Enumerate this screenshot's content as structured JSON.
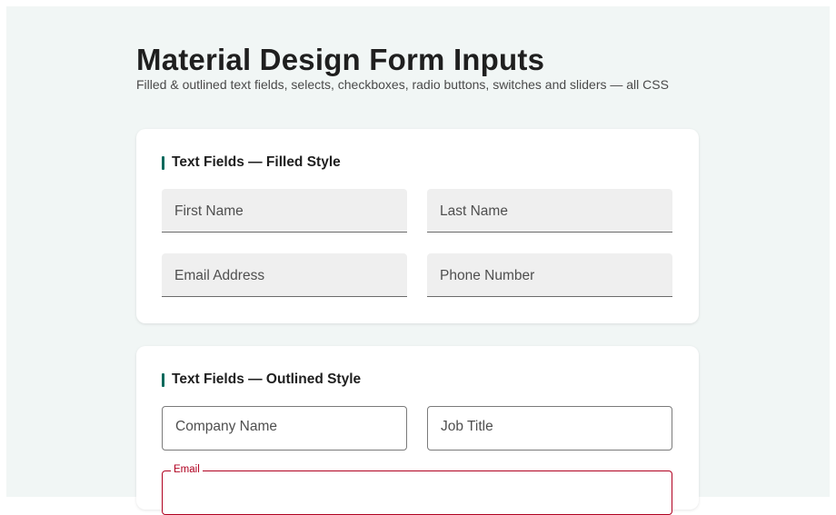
{
  "header": {
    "title": "Material Design Form Inputs",
    "subtitle": "Filled & outlined text fields, selects, checkboxes, radio buttons, switches and sliders — all CSS"
  },
  "filled_section": {
    "title": "Text Fields — Filled Style",
    "fields": {
      "first_name": {
        "placeholder": "First Name",
        "value": ""
      },
      "last_name": {
        "placeholder": "Last Name",
        "value": ""
      },
      "email": {
        "placeholder": "Email Address",
        "value": ""
      },
      "phone": {
        "placeholder": "Phone Number",
        "value": ""
      }
    }
  },
  "outlined_section": {
    "title": "Text Fields — Outlined Style",
    "fields": {
      "company": {
        "placeholder": "Company Name",
        "value": ""
      },
      "job_title": {
        "placeholder": "Job Title",
        "value": ""
      },
      "email": {
        "label": "Email",
        "value": "",
        "state": "error"
      }
    }
  },
  "colors": {
    "page_background": "#f1f6f5",
    "accent": "#00695c",
    "error": "#b00020",
    "filled_field_background": "#efefef"
  }
}
